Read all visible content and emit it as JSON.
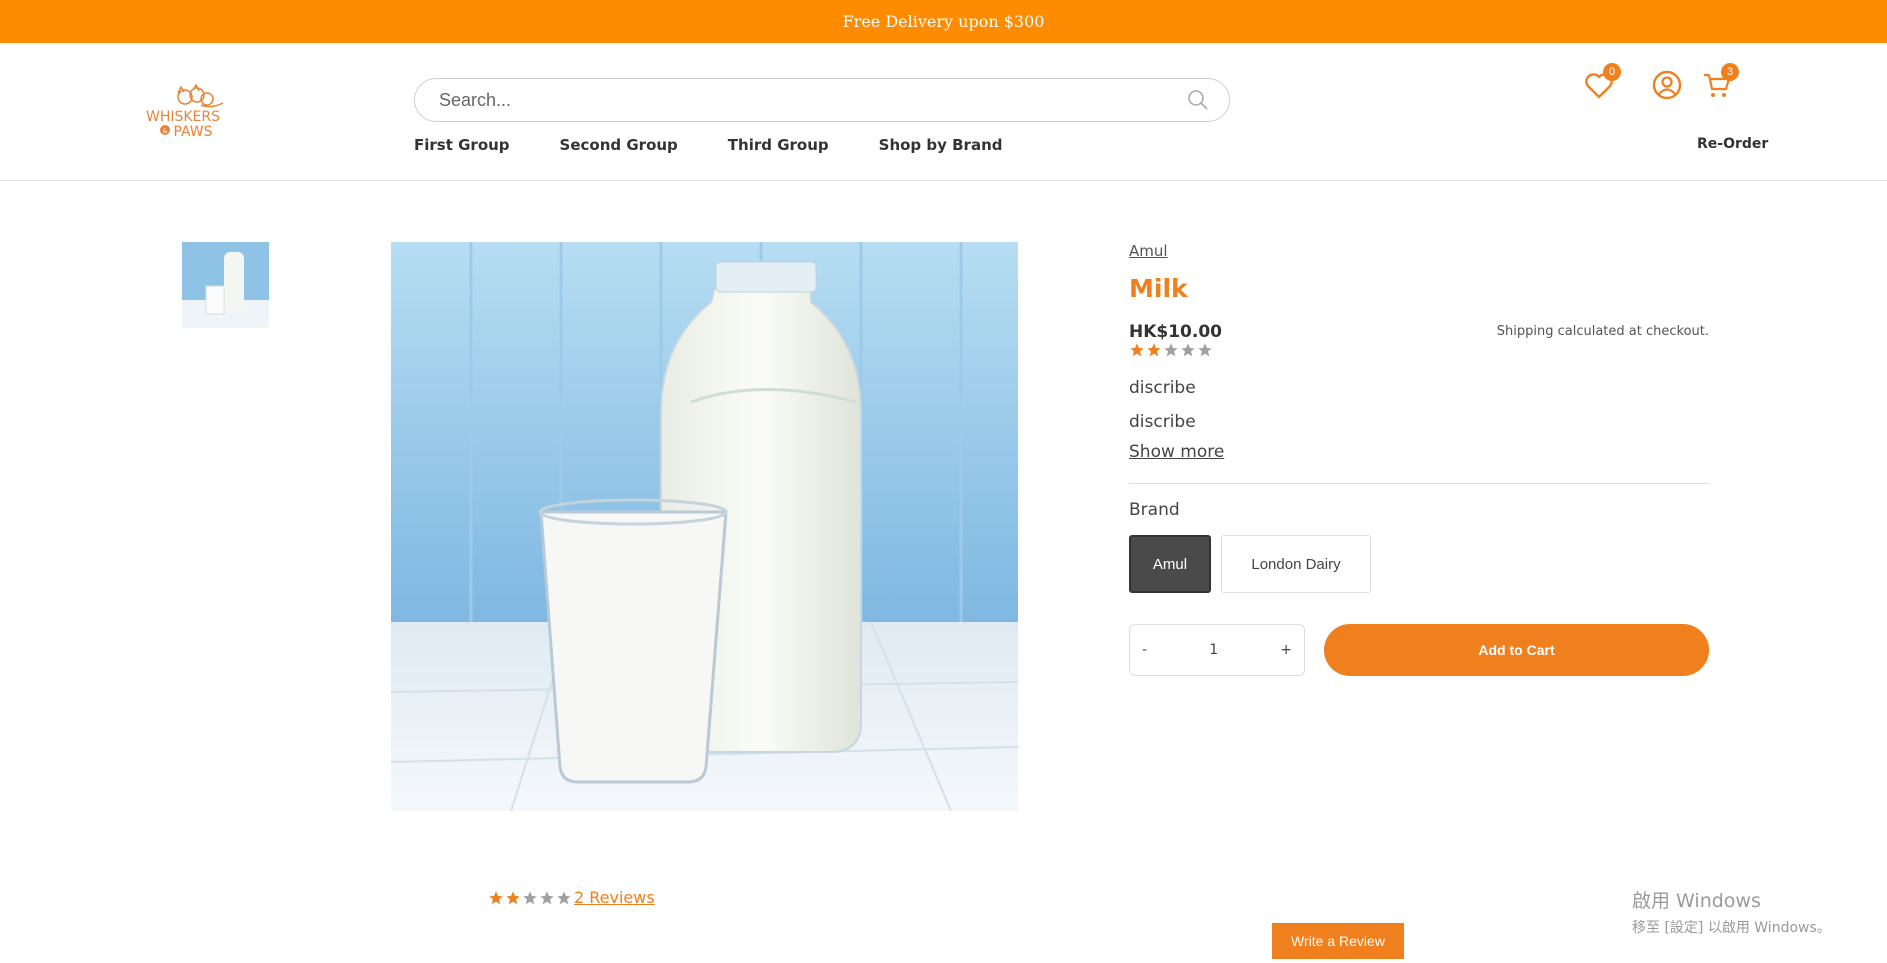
{
  "promo": {
    "text": "Free Delivery upon $300"
  },
  "logo": {
    "alt": "Whiskers & Paws"
  },
  "search": {
    "placeholder": "Search..."
  },
  "nav": {
    "items": [
      "First Group",
      "Second Group",
      "Third Group",
      "Shop by Brand"
    ]
  },
  "header": {
    "wishlist_count": "0",
    "cart_count": "3",
    "reorder_label": "Re-Order"
  },
  "product": {
    "brand": "Amul",
    "title": "Milk",
    "price": "HK$10.00",
    "shipping": "Shipping calculated at checkout.",
    "rating": 2,
    "rating_max": 5,
    "descriptions": [
      "discribe",
      "discribe"
    ],
    "show_more": "Show more",
    "brand_label": "Brand",
    "brand_options": [
      "Amul",
      "London Dairy"
    ],
    "selected_brand": "Amul",
    "quantity": "1",
    "qty_minus": "-",
    "qty_plus": "+",
    "add_to_cart": "Add to Cart"
  },
  "reviews": {
    "count_label": "2 Reviews",
    "write_label": "Write a Review"
  },
  "watermark": {
    "line1": "啟用 Windows",
    "line2": "移至 [設定] 以啟用 Windows。"
  },
  "colors": {
    "accent": "#f07f1d",
    "promo": "#ff8c00",
    "star_off": "#a0a0a0"
  }
}
